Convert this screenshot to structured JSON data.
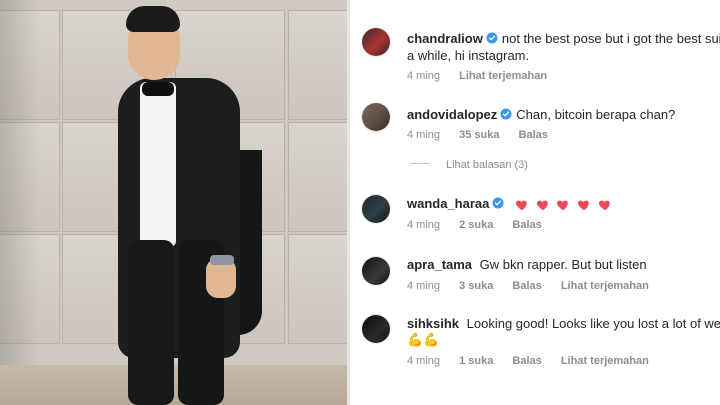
{
  "comments": [
    {
      "user": "chandraliow",
      "verified": true,
      "text": "not the best pose but i got the best suit!",
      "text2": "a while, hi instagram.",
      "meta": [
        "4 ming",
        "Lihat terjemahan"
      ]
    },
    {
      "user": "andovidalopez",
      "verified": true,
      "text": "Chan, bitcoin berapa chan?",
      "meta": [
        "4 ming",
        "35 suka",
        "Balas"
      ],
      "replies_label": "Lihat balasan (3)"
    },
    {
      "user": "wanda_haraa",
      "verified": true,
      "hearts": 5,
      "meta": [
        "4 ming",
        "2 suka",
        "Balas"
      ]
    },
    {
      "user": "apra_tama",
      "verified": false,
      "text": "Gw bkn rapper. But but listen",
      "meta": [
        "4 ming",
        "3 suka",
        "Balas",
        "Lihat terjemahan"
      ]
    },
    {
      "user": "sihksihk",
      "verified": false,
      "text": "Looking good! Looks like you lost a lot of weigh",
      "emoji": "💪💪",
      "meta": [
        "4 ming",
        "1 suka",
        "Balas",
        "Lihat terjemahan"
      ]
    }
  ],
  "colors": {
    "verified": "#3897f0",
    "heart": "#ed4956",
    "muted": "#8e8e8e"
  }
}
